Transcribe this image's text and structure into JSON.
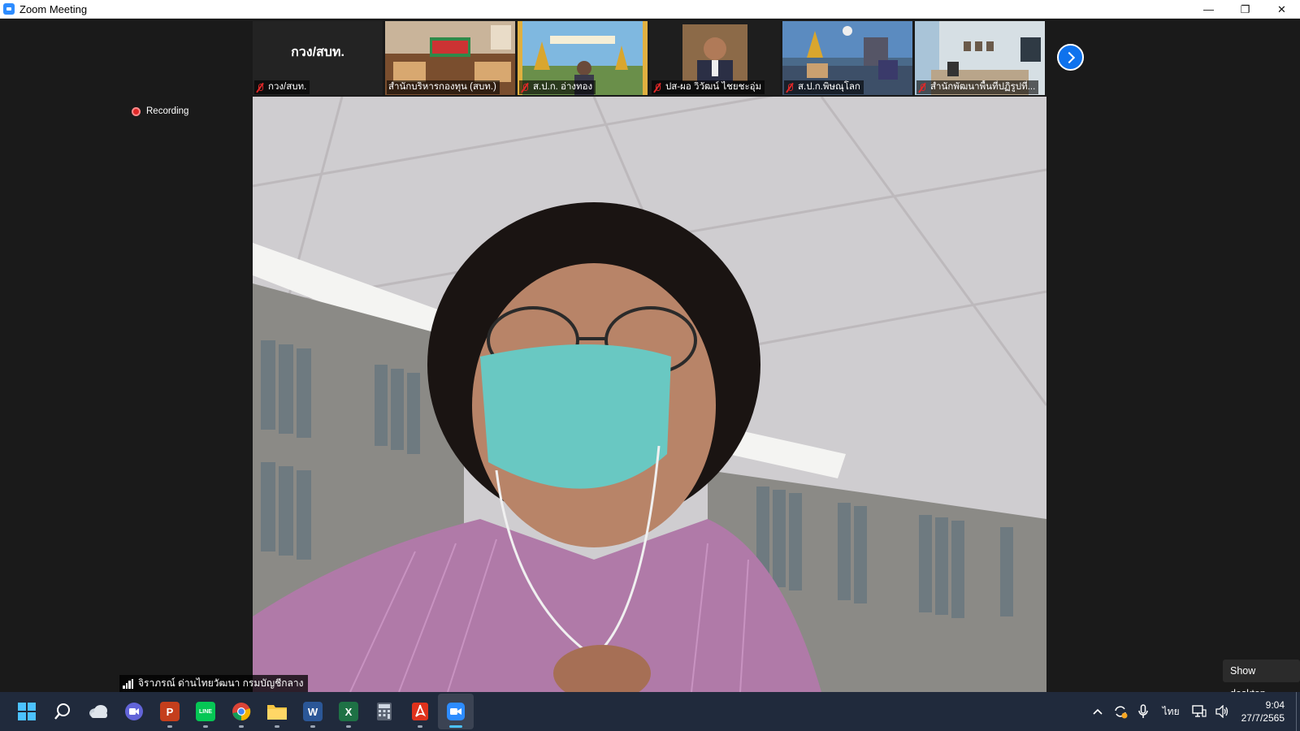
{
  "window": {
    "title": "Zoom Meeting",
    "controls": {
      "minimize": "—",
      "restore": "❐",
      "close": "✕"
    }
  },
  "gallery": {
    "tiles": [
      {
        "type": "name-only",
        "display_name": "กวง/สบท.",
        "label": "กวง/สบท.",
        "muted": true
      },
      {
        "type": "video",
        "label": "สำนักบริหารกองทุน (สบท.)",
        "muted": false
      },
      {
        "type": "video",
        "label": "ส.ป.ก. อ่างทอง",
        "muted": true
      },
      {
        "type": "video",
        "label": "ปส-ผอ วิวัฒน์ ไชยชะอุ่ม",
        "muted": true
      },
      {
        "type": "video",
        "label": "ส.ป.ก.พิษณุโลก",
        "muted": true
      },
      {
        "type": "video",
        "label": "สำนักพัฒนาพื้นที่ปฏิรูปที่...",
        "muted": true
      }
    ],
    "next_page_icon": "chevron-right-icon"
  },
  "recording": {
    "label": "Recording",
    "color": "#e02828"
  },
  "active_speaker": {
    "label": "จิราภรณ์ ด่านไทยวัฒนา กรมบัญชีกลาง"
  },
  "show_desktop": {
    "label": "Show desktop"
  },
  "taskbar": {
    "apps": [
      {
        "name": "start-button",
        "icon": "windows-icon"
      },
      {
        "name": "search-button",
        "icon": "search-icon"
      },
      {
        "name": "weather-widget",
        "icon": "cloud-icon"
      },
      {
        "name": "teams-chat",
        "icon": "video-chat-icon"
      },
      {
        "name": "powerpoint",
        "icon": "powerpoint-icon",
        "letter": "P",
        "color": "#c43e1c"
      },
      {
        "name": "line",
        "icon": "line-icon",
        "letter": "LINE",
        "color": "#06c755"
      },
      {
        "name": "chrome",
        "icon": "chrome-icon"
      },
      {
        "name": "file-explorer",
        "icon": "folder-icon",
        "color": "#f5c542"
      },
      {
        "name": "word",
        "icon": "word-icon",
        "letter": "W",
        "color": "#2b5797"
      },
      {
        "name": "excel",
        "icon": "excel-icon",
        "letter": "X",
        "color": "#1e7145"
      },
      {
        "name": "calculator",
        "icon": "calculator-icon"
      },
      {
        "name": "acrobat",
        "icon": "acrobat-icon",
        "color": "#e0321c"
      },
      {
        "name": "zoom",
        "icon": "zoom-icon",
        "color": "#2d8cff",
        "active": true
      }
    ],
    "tray": {
      "language": "ไทย",
      "time": "9:04",
      "date": "27/7/2565"
    }
  }
}
